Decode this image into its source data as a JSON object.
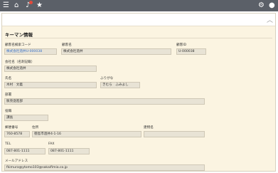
{
  "topbar": {
    "icons": [
      "menu-icon",
      "home-icon",
      "bell-icon",
      "star-icon",
      "gear-icon",
      "user-icon"
    ]
  },
  "section": {
    "title": "キーマン情報"
  },
  "fields": {
    "customer_code": {
      "label": "顧客名検索コード",
      "value": "株式会社酒井U-000038"
    },
    "customer_name": {
      "label": "顧客名",
      "value": "株式会社酒井"
    },
    "customer_id": {
      "label": "顧客ID",
      "value": "U-000038"
    },
    "company_official": {
      "label": "会社名（名刺記載）",
      "value": "株式会社酒井"
    },
    "name": {
      "label": "氏名",
      "value": "木村　文義"
    },
    "furigana": {
      "label": "ふりがな",
      "value": "きむら　ふみよし"
    },
    "department": {
      "label": "部署",
      "value": "販売促進部"
    },
    "position": {
      "label": "役職",
      "value": "課長"
    },
    "postal_code": {
      "label": "郵便番号",
      "value": "760-8578"
    },
    "address": {
      "label": "住所",
      "value": "徳島市酒井4-1-16"
    },
    "building": {
      "label": "建物名",
      "value": ""
    },
    "tel": {
      "label": "TEL",
      "value": "087-801-1111"
    },
    "fax": {
      "label": "FAX",
      "value": "087-801-1111"
    },
    "email": {
      "label": "メールアドレス",
      "value": "fkimura@ytomo103@sakaifimia.co.jp"
    }
  }
}
